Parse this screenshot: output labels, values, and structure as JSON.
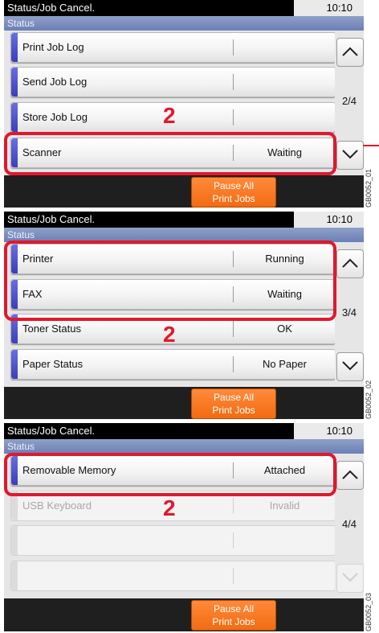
{
  "screens": [
    {
      "title": "Status/Job Cancel.",
      "time": "10:10",
      "status_tab": "Status",
      "rows": [
        {
          "label": "Print Job Log",
          "value": ""
        },
        {
          "label": "Send Job Log",
          "value": ""
        },
        {
          "label": "Store Job Log",
          "value": ""
        },
        {
          "label": "Scanner",
          "value": "Waiting"
        }
      ],
      "page": "2/4",
      "pause_line1": "Pause All",
      "pause_line2": "Print Jobs",
      "callout": "2",
      "code": "GB0052_01"
    },
    {
      "title": "Status/Job Cancel.",
      "time": "10:10",
      "status_tab": "Status",
      "rows": [
        {
          "label": "Printer",
          "value": "Running"
        },
        {
          "label": "FAX",
          "value": "Waiting"
        },
        {
          "label": "Toner Status",
          "value": "OK"
        },
        {
          "label": "Paper Status",
          "value": "No Paper"
        }
      ],
      "page": "3/4",
      "pause_line1": "Pause All",
      "pause_line2": "Print Jobs",
      "callout": "2",
      "code": "GB0052_02"
    },
    {
      "title": "Status/Job Cancel.",
      "time": "10:10",
      "status_tab": "Status",
      "rows": [
        {
          "label": "Removable Memory",
          "value": "Attached"
        },
        {
          "label": "USB Keyboard",
          "value": "Invalid"
        },
        {
          "label": "",
          "value": ""
        },
        {
          "label": "",
          "value": ""
        }
      ],
      "page": "4/4",
      "pause_line1": "Pause All",
      "pause_line2": "Print Jobs",
      "callout": "2",
      "code": "GB0052_03"
    }
  ],
  "colors": {
    "highlight": "#e0182d",
    "accent_bar": "#3b3fb8",
    "pause_button": "#f26b12"
  }
}
